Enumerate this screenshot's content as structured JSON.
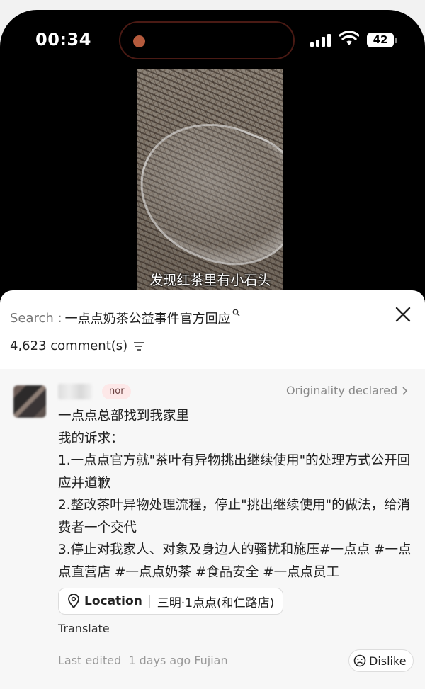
{
  "status_bar": {
    "time": "00:34",
    "battery": "42"
  },
  "video": {
    "caption": "发现红茶里有小石头"
  },
  "sheet": {
    "search_label": "Search :",
    "search_query": "一点点奶茶公益事件官方回应",
    "comment_count": "4,623 comment(s)"
  },
  "comment": {
    "badge": "nor",
    "originality": "Originality declared",
    "lines": [
      "一点点总部找到我家里",
      "我的诉求：",
      "1.一点点官方就\"茶叶有异物挑出继续使用\"的处理方式公开回应并道歉",
      "2.整改茶叶异物处理流程，停止\"挑出继续使用\"的做法，给消费者一个交代",
      "3.停止对我家人、对象及身边人的骚扰和施压#一点点 #一点点直营店 #一点点奶茶 #食品安全 #一点点员工"
    ],
    "location_label": "Location",
    "location_value": "三明·1点点(和仁路店)",
    "translate": "Translate",
    "edited_label": "Last edited",
    "edited_time": "1 days ago",
    "edited_region": "Fujian",
    "dislike": "Dislike"
  },
  "colors": {
    "badge_bg": "#fde8e8",
    "island_border": "#4a1a14",
    "camera_dot": "#b45a3c"
  }
}
